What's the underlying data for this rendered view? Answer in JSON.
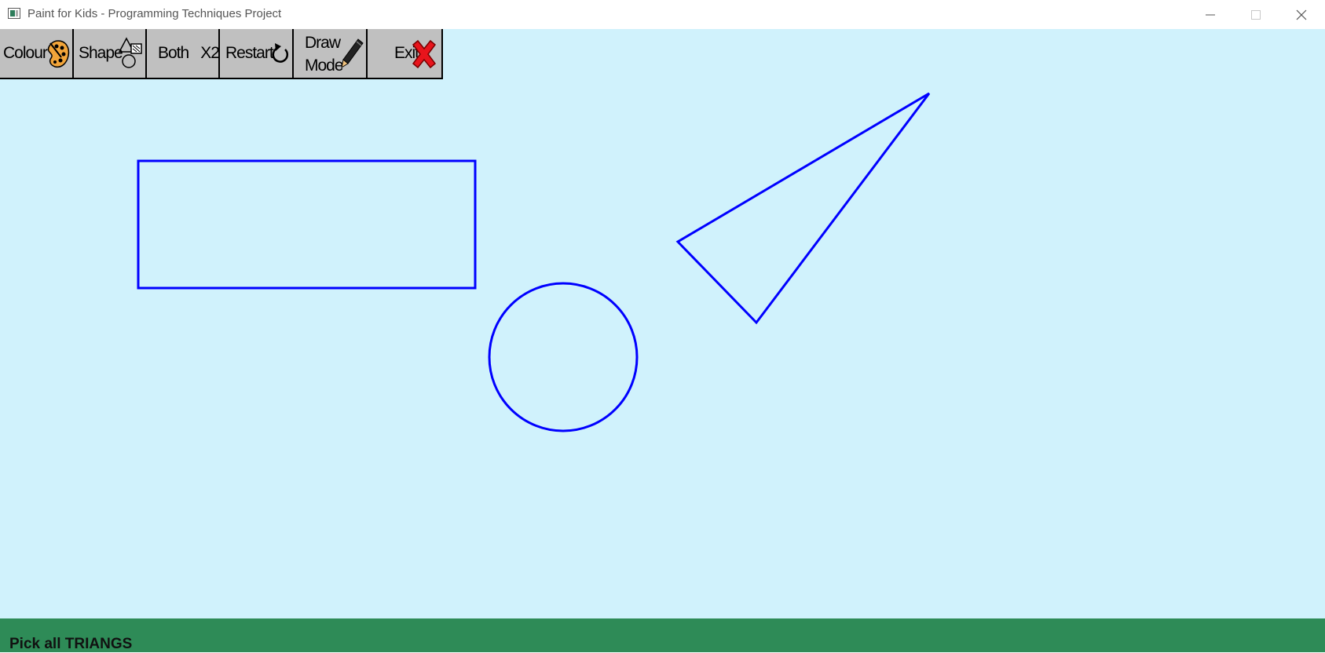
{
  "window": {
    "title": "Paint for Kids - Programming Techniques Project",
    "minimize_icon": "minimize-icon",
    "maximize_icon": "maximize-icon",
    "close_icon": "close-icon"
  },
  "toolbar": {
    "colour": {
      "label": "Colour",
      "icon": "palette-icon"
    },
    "shape": {
      "label": "Shape",
      "icon": "shapes-icon"
    },
    "both": {
      "label": "Both",
      "secondary": "X2"
    },
    "restart": {
      "label": "Restart",
      "icon": "restart-arrow-icon"
    },
    "draw_mode": {
      "label_line1": "Draw",
      "label_line2": "Mode",
      "icon": "pencil-icon"
    },
    "exit": {
      "label": "Exit",
      "icon": "red-x-icon"
    }
  },
  "canvas": {
    "background": "#d0f2fc",
    "shapes": [
      {
        "type": "rectangle",
        "stroke": "#0000ff",
        "fill": "none"
      },
      {
        "type": "circle",
        "stroke": "#0000ff",
        "fill": "none"
      },
      {
        "type": "triangle",
        "stroke": "#0000ff",
        "fill": "none"
      }
    ]
  },
  "status_bar": {
    "message": "Pick all TRIANGS",
    "background": "#2e8b57"
  }
}
